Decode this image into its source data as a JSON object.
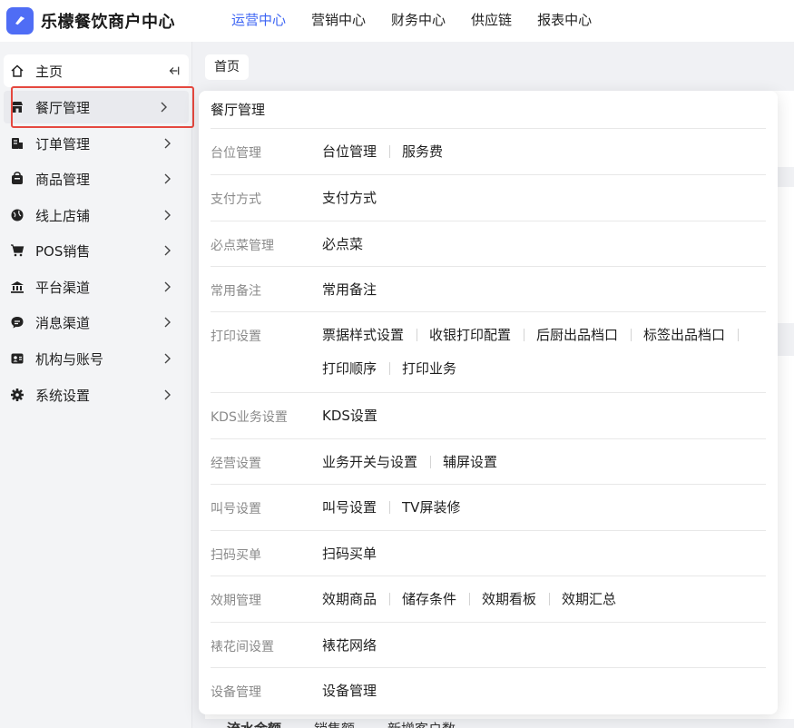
{
  "brand": {
    "name": "乐檬餐饮商户中心",
    "accent": "#4f6df5"
  },
  "topnav": [
    {
      "label": "运营中心",
      "active": true
    },
    {
      "label": "营销中心",
      "active": false
    },
    {
      "label": "财务中心",
      "active": false
    },
    {
      "label": "供应链",
      "active": false
    },
    {
      "label": "报表中心",
      "active": false
    }
  ],
  "sidebar": {
    "items": [
      {
        "label": "主页",
        "icon": "home-icon"
      },
      {
        "label": "餐厅管理",
        "icon": "store-icon"
      },
      {
        "label": "订单管理",
        "icon": "order-icon"
      },
      {
        "label": "商品管理",
        "icon": "goods-icon"
      },
      {
        "label": "线上店铺",
        "icon": "globe-icon"
      },
      {
        "label": "POS销售",
        "icon": "cart-icon"
      },
      {
        "label": "平台渠道",
        "icon": "bank-icon"
      },
      {
        "label": "消息渠道",
        "icon": "message-icon"
      },
      {
        "label": "机构与账号",
        "icon": "account-icon"
      },
      {
        "label": "系统设置",
        "icon": "gear-icon"
      }
    ]
  },
  "breadcrumb": "首页",
  "panel": {
    "title": "餐厅管理",
    "rows": [
      {
        "category": "台位管理",
        "links": [
          "台位管理",
          "服务费"
        ]
      },
      {
        "category": "支付方式",
        "links": [
          "支付方式"
        ]
      },
      {
        "category": "必点菜管理",
        "links": [
          "必点菜"
        ]
      },
      {
        "category": "常用备注",
        "links": [
          "常用备注"
        ]
      },
      {
        "category": "打印设置",
        "links": [
          "票据样式设置",
          "收银打印配置",
          "后厨出品档口",
          "标签出品档口",
          "打印顺序",
          "打印业务"
        ]
      },
      {
        "category": "KDS业务设置",
        "links": [
          "KDS设置"
        ]
      },
      {
        "category": "经营设置",
        "links": [
          "业务开关与设置",
          "辅屏设置"
        ]
      },
      {
        "category": "叫号设置",
        "links": [
          "叫号设置",
          "TV屏装修"
        ]
      },
      {
        "category": "扫码买单",
        "links": [
          "扫码买单"
        ]
      },
      {
        "category": "效期管理",
        "links": [
          "效期商品",
          "储存条件",
          "效期看板",
          "效期汇总"
        ]
      },
      {
        "category": "裱花间设置",
        "links": [
          "裱花网络"
        ]
      },
      {
        "category": "设备管理",
        "links": [
          "设备管理"
        ]
      }
    ]
  },
  "bottom_tabs": [
    "流水金额",
    "销售额",
    "新增客户数"
  ]
}
